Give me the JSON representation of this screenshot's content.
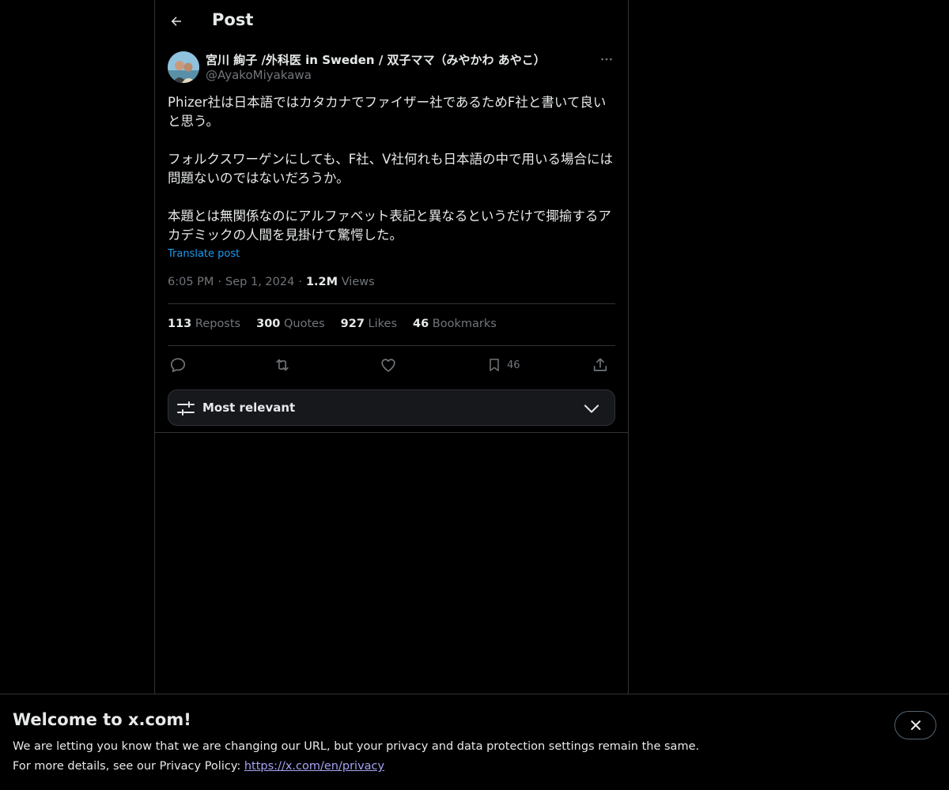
{
  "header": {
    "title": "Post",
    "back_icon": "arrow-left-icon"
  },
  "post": {
    "display_name": "宮川 絢子 /外科医 in Sweden / 双子ママ（みやかわ あやこ）",
    "handle": "@AyakoMiyakawa",
    "paragraphs": [
      "Phizer社は日本語ではカタカナでファイザー社であるためF社と書いて良いと思う。",
      "フォルクスワーゲンにしても、F社、V社何れも日本語の中で用いる場合には問題ないのではないだろうか。",
      "本題とは無関係なのにアルファベット表記と異なるというだけで揶揄するアカデミックの人間を見掛けて驚愕した。"
    ],
    "translate_label": "Translate post",
    "time": "6:05 PM",
    "date": "Sep 1, 2024",
    "views_count": "1.2M",
    "views_label": "Views",
    "separator": "·"
  },
  "stats": {
    "reposts": {
      "count": "113",
      "label": "Reposts"
    },
    "quotes": {
      "count": "300",
      "label": "Quotes"
    },
    "likes": {
      "count": "927",
      "label": "Likes"
    },
    "bookmarks": {
      "count": "46",
      "label": "Bookmarks"
    }
  },
  "actions": {
    "reply_icon": "reply-icon",
    "repost_icon": "repost-icon",
    "like_icon": "heart-icon",
    "bookmark_icon": "bookmark-icon",
    "bookmark_count": "46",
    "share_icon": "share-icon"
  },
  "sort": {
    "label": "Most relevant"
  },
  "banner": {
    "title": "Welcome to x.com!",
    "line1": "We are letting you know that we are changing our URL, but your privacy and data protection settings remain the same.",
    "line2_prefix": "For more details, see our Privacy Policy: ",
    "link": "https://x.com/en/privacy"
  },
  "colors": {
    "background": "#000000",
    "text": "#e7e9ea",
    "muted": "#71767b",
    "accent": "#1d9bf0",
    "link": "#a5a3f5"
  }
}
